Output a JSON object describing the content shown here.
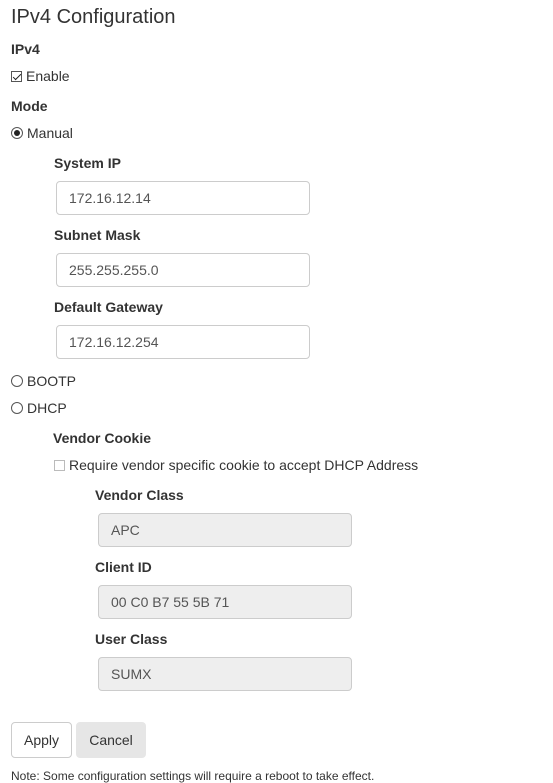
{
  "page": {
    "title": "IPv4 Configuration"
  },
  "ipv4": {
    "heading": "IPv4",
    "enable_label": "Enable",
    "enabled": true
  },
  "mode": {
    "heading": "Mode",
    "manual_label": "Manual",
    "bootp_label": "BOOTP",
    "dhcp_label": "DHCP",
    "selected": "Manual"
  },
  "manual": {
    "system_ip_label": "System IP",
    "system_ip_value": "172.16.12.14",
    "subnet_mask_label": "Subnet Mask",
    "subnet_mask_value": "255.255.255.0",
    "default_gateway_label": "Default Gateway",
    "default_gateway_value": "172.16.12.254"
  },
  "dhcp": {
    "vendor_cookie_heading": "Vendor Cookie",
    "require_cookie_label": "Require vendor specific cookie to accept DHCP Address",
    "require_cookie_checked": false,
    "vendor_class_label": "Vendor Class",
    "vendor_class_value": "APC",
    "client_id_label": "Client ID",
    "client_id_value": "00 C0 B7 55 5B 71",
    "user_class_label": "User Class",
    "user_class_value": "SUMX"
  },
  "actions": {
    "apply_label": "Apply",
    "cancel_label": "Cancel"
  },
  "note": {
    "text": "Note: Some configuration settings will require a reboot to take effect."
  }
}
